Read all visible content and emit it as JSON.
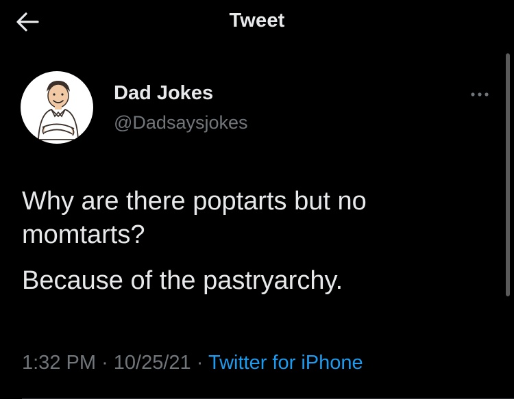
{
  "header": {
    "title": "Tweet",
    "back_icon": "arrow-left-icon"
  },
  "author": {
    "name": "Dad Jokes",
    "handle": "@Dadsaysjokes",
    "avatar_icon": "cartoon-dad-avatar",
    "more_icon": "more-horizontal-icon"
  },
  "tweet": {
    "paragraphs": [
      "Why are there poptarts but no momtarts?",
      "Because of the pastryarchy."
    ]
  },
  "meta": {
    "time": "1:32 PM",
    "separator": "·",
    "date": "10/25/21",
    "source": "Twitter for iPhone"
  },
  "colors": {
    "background": "#000000",
    "text": "#e7e9ea",
    "secondary": "#71767b",
    "accent": "#1d9bf0"
  }
}
